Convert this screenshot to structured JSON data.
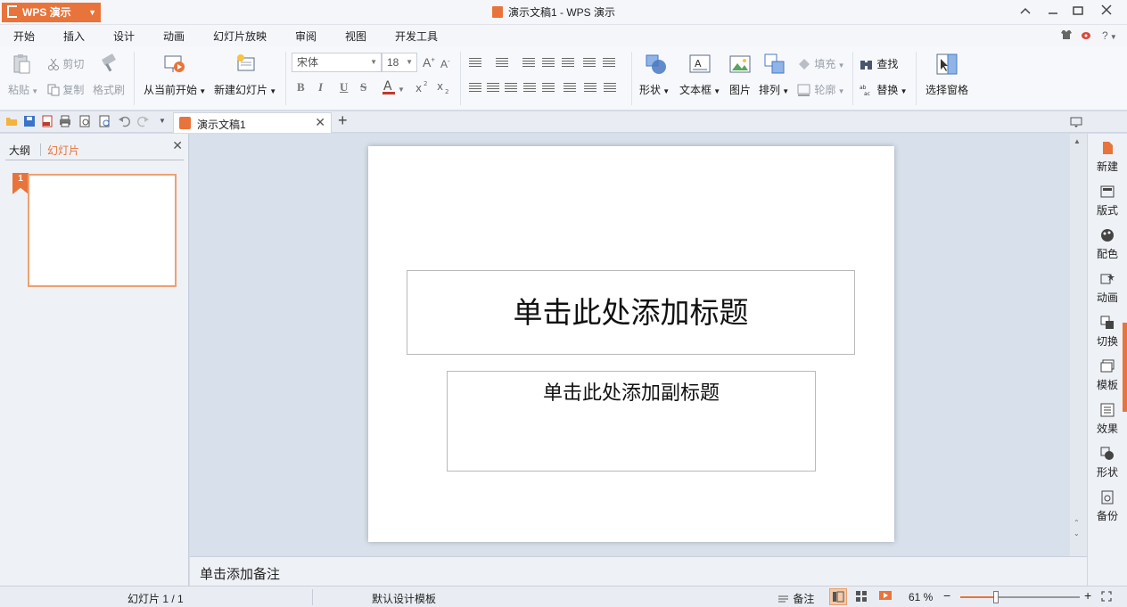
{
  "app": {
    "brand_label": "WPS 演示",
    "window_title": "演示文稿1 - WPS 演示"
  },
  "menu": {
    "tabs": [
      "开始",
      "插入",
      "设计",
      "动画",
      "幻灯片放映",
      "审阅",
      "视图",
      "开发工具"
    ],
    "active_tab": "开始",
    "help_label": "?"
  },
  "ribbon": {
    "paste": "粘贴",
    "cut": "剪切",
    "copy": "复制",
    "format_painter": "格式刷",
    "from_current": "从当前开始",
    "new_slide": "新建幻灯片",
    "font_name": "宋体",
    "font_size": "18",
    "shape": "形状",
    "textbox": "文本框",
    "picture": "图片",
    "arrange": "排列",
    "fill": "填充",
    "outline": "轮廓",
    "find": "查找",
    "replace": "替换",
    "selection_pane": "选择窗格",
    "format_buttons": [
      "B",
      "I",
      "U",
      "S"
    ]
  },
  "tabstrip": {
    "doc_tab": "演示文稿1",
    "new_tab": "+"
  },
  "left_panel": {
    "tab_outline": "大纲",
    "tab_slides": "幻灯片",
    "slide_number": "1"
  },
  "slide": {
    "title_placeholder": "单击此处添加标题",
    "subtitle_placeholder": "单击此处添加副标题"
  },
  "notes": {
    "placeholder": "单击添加备注"
  },
  "right_panel": {
    "items": [
      "新建",
      "版式",
      "配色",
      "动画",
      "切换",
      "模板",
      "效果",
      "形状",
      "备份"
    ]
  },
  "status": {
    "slide_counter": "幻灯片 1 / 1",
    "template": "默认设计模板",
    "notes_toggle": "备注",
    "zoom": "61 %",
    "zoom_fraction": 0.3
  },
  "colors": {
    "accent": "#e8743b"
  }
}
